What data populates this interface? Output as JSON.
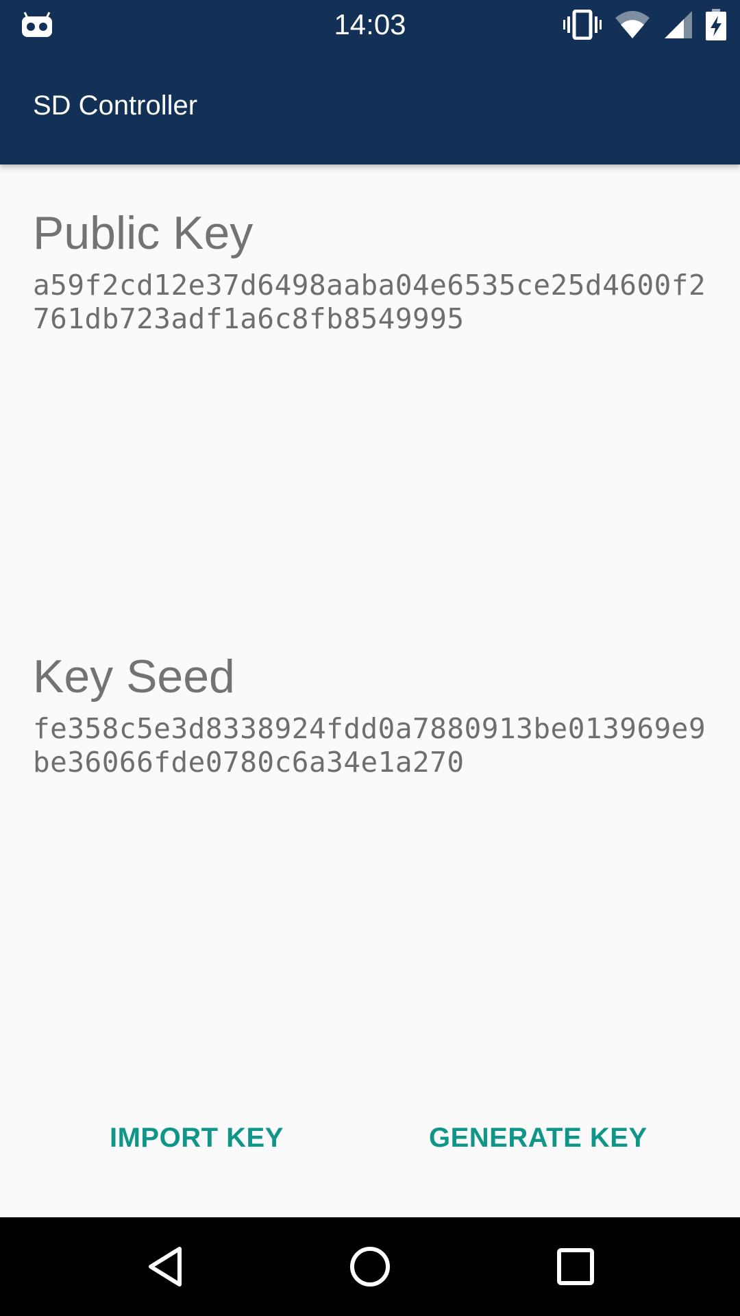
{
  "status_bar": {
    "time": "14:03",
    "notification_icon": "cyanogen-robot-icon",
    "icons": [
      "vibrate-icon",
      "wifi-icon",
      "cell-signal-icon",
      "battery-charging-icon"
    ]
  },
  "app_bar": {
    "title": "SD Controller",
    "color": "#133156"
  },
  "public_key": {
    "heading": "Public Key",
    "value": "a59f2cd12e37d6498aaba04e6535ce25d4600f2761db723adf1a6c8fb8549995"
  },
  "key_seed": {
    "heading": "Key Seed",
    "value": "fe358c5e3d8338924fdd0a7880913be013969e9be36066fde0780c6a34e1a270"
  },
  "actions": {
    "import_label": "IMPORT KEY",
    "generate_label": "GENERATE KEY",
    "accent_color": "#109688"
  },
  "nav_bar": {
    "buttons": [
      "back-icon",
      "home-icon",
      "recents-icon"
    ]
  }
}
